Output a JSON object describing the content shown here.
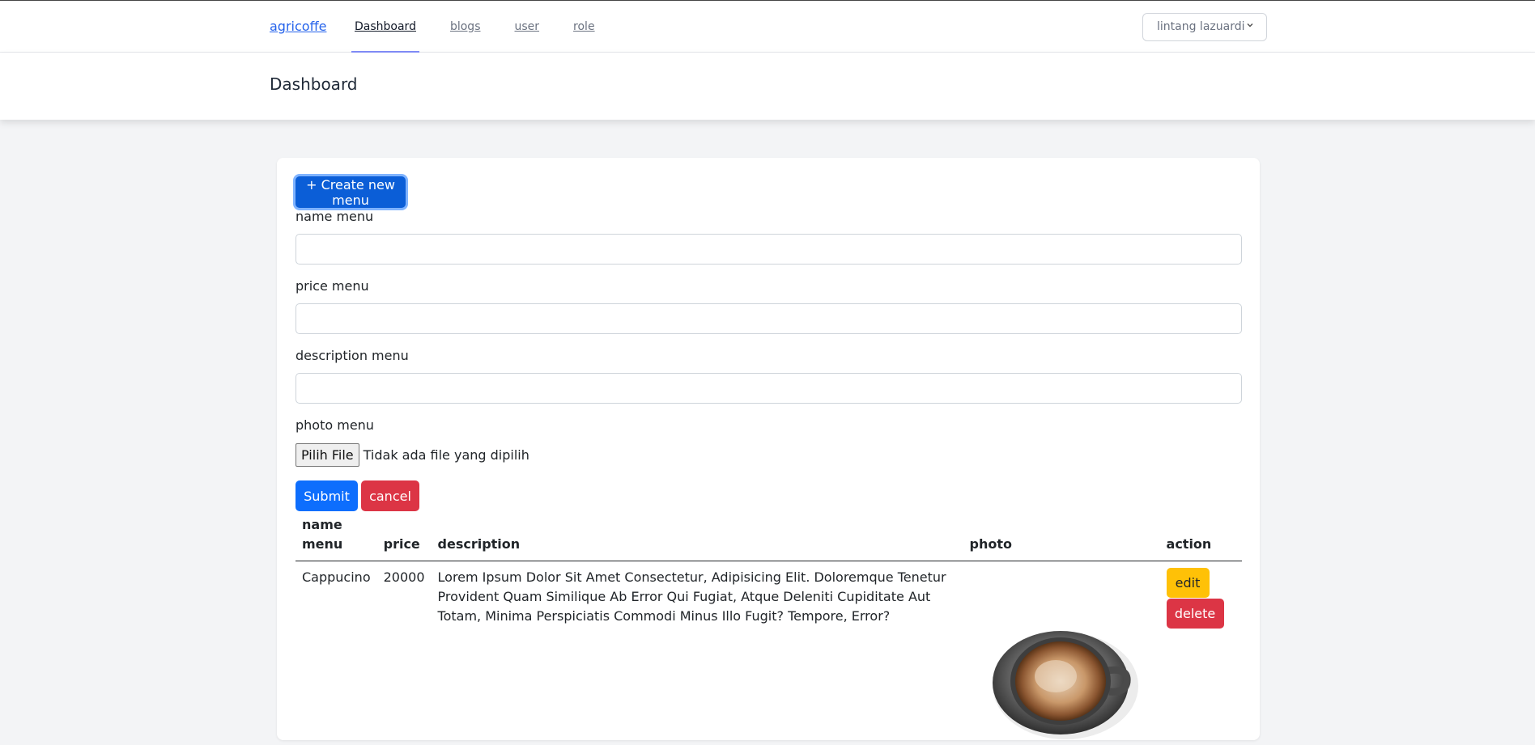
{
  "nav": {
    "brand": "agricoffe",
    "links": [
      {
        "label": "Dashboard",
        "active": true
      },
      {
        "label": "blogs",
        "active": false
      },
      {
        "label": "user",
        "active": false
      },
      {
        "label": "role",
        "active": false
      }
    ],
    "user_name": "lintang lazuardi",
    "user_icon": "chevron-down-icon"
  },
  "header": {
    "title": "Dashboard"
  },
  "form": {
    "create_label": "+ Create new menu",
    "name_label": "name menu",
    "name_value": "",
    "price_label": "price menu",
    "price_value": "",
    "description_label": "description menu",
    "description_value": "",
    "photo_label": "photo menu",
    "file_button_label": "Pilih File",
    "file_status": "Tidak ada file yang dipilih",
    "submit_label": "Submit",
    "cancel_label": "cancel"
  },
  "table": {
    "headers": [
      "name menu",
      "price",
      "description",
      "photo",
      "action"
    ],
    "rows": [
      {
        "name": "Cappucino",
        "price": "20000",
        "description": "Lorem Ipsum Dolor Sit Amet Consectetur, Adipisicing Elit. Doloremque Tenetur Provident Quam Similique Ab Error Qui Fugiat, Atque Deleniti Cupiditate Aut Totam, Minima Perspiciatis Commodi Minus Illo Fugit? Tempore, Error?",
        "photo_alt": "cappuccino cup",
        "edit_label": "edit",
        "delete_label": "delete"
      }
    ]
  },
  "colors": {
    "primary": "#0d6efd",
    "danger": "#dc3545",
    "warning": "#ffc107",
    "link": "#2563eb"
  }
}
